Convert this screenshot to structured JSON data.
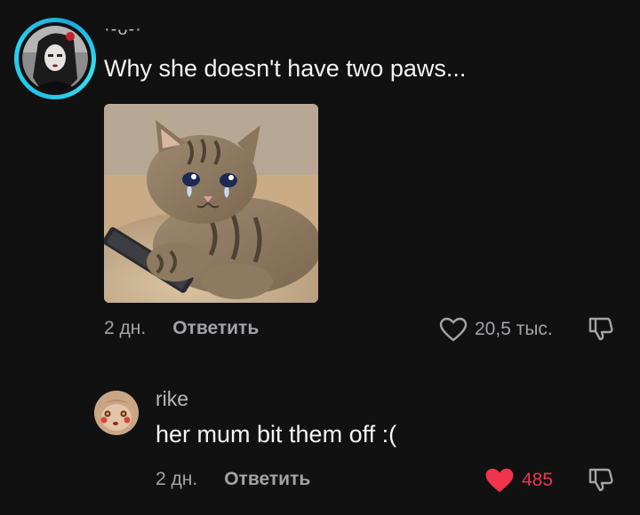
{
  "comment": {
    "username": "·-ᴗ-·",
    "text": "Why she doesn't have two paws...",
    "date": "2 дн.",
    "reply_label": "Ответить",
    "likes": "20,5 тыс.",
    "liked": false,
    "attachment": "crying-cat-sticker"
  },
  "reply": {
    "username": "rike",
    "text": "her mum bit them off :(",
    "date": "2 дн.",
    "reply_label": "Ответить",
    "likes": "485",
    "liked": true
  },
  "colors": {
    "background": "#111112",
    "avatar_ring": "#1ec6e8",
    "liked_heart": "#f0344e",
    "secondary_text": "#a3a3a8"
  }
}
